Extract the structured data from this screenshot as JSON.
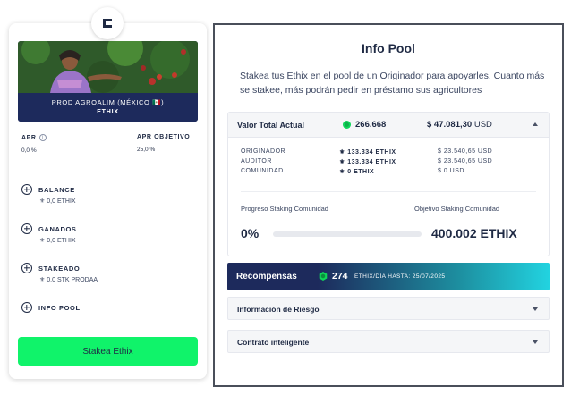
{
  "left_card": {
    "logo_letter": "C",
    "originator_name": "PROD AGROALIM (MÉXICO 🇲🇽)",
    "originator_token": "ETHIX",
    "apr_label": "APR",
    "apr_value": "0,0 %",
    "apr_target_label": "APR OBJETIVO",
    "apr_target_value": "25,0 %",
    "stats": [
      {
        "label": "BALANCE",
        "value": "0,0 ETHIX"
      },
      {
        "label": "GANADOS",
        "value": "0,0 ETHIX"
      },
      {
        "label": "STAKEADO",
        "value": "0,0 STK PRODAA"
      },
      {
        "label": "INFO POOL",
        "value": ""
      }
    ],
    "stake_button": "Stakea Ethix"
  },
  "info_pool": {
    "title": "Info Pool",
    "description": "Stakea tus Ethix en el pool de un Originador para apoyarles. Cuanto más se stakee, más podrán pedir en préstamo sus agricultores",
    "tvl": {
      "label": "Valor Total Actual",
      "ethix": "266.668",
      "usd_amount": "$ 47.081,30",
      "usd_unit": "USD"
    },
    "breakdown": [
      {
        "role": "ORIGINADOR",
        "ethix": "133.334 ETHIX",
        "usd": "$ 23.540,65 USD"
      },
      {
        "role": "AUDITOR",
        "ethix": "133.334 ETHIX",
        "usd": "$ 23.540,65 USD"
      },
      {
        "role": "COMUNIDAD",
        "ethix": "0 ETHIX",
        "usd": "$ 0 USD"
      }
    ],
    "progress_label": "Progreso Staking Comunidad",
    "target_label": "Objetivo Staking Comunidad",
    "progress_percent_text": "0%",
    "progress_fraction": 0,
    "target_value": "400.002 ETHIX",
    "rewards": {
      "label": "Recompensas",
      "value": "274",
      "unit": "ETHIX/DÍA HASTA: 25/07/2025"
    },
    "accordions": [
      {
        "label": "Información de Riesgo"
      },
      {
        "label": "Contrato inteligente"
      }
    ]
  },
  "colors": {
    "accent_green": "#10f36a",
    "navy": "#1d2a5c",
    "teal": "#22d3e0"
  }
}
